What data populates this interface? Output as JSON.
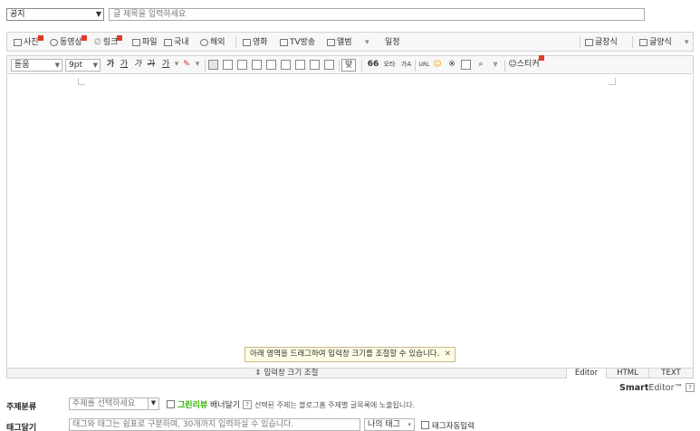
{
  "post": {
    "category": "공지",
    "title_placeholder": "글 제목을 입력하세요"
  },
  "toolbar1": {
    "photo": "사진",
    "video": "동영상",
    "link": "링크",
    "file": "파일",
    "domestic": "국내",
    "overseas": "해외",
    "movie": "영화",
    "tv": "TV방송",
    "album": "앨범",
    "schedule": "일정",
    "text_style": "글장식",
    "template": "글양식"
  },
  "toolbar2": {
    "font": "돋움",
    "size": "9pt",
    "bold": "가",
    "underline": "가",
    "italic": "가",
    "strike": "가",
    "font_color": "가",
    "bg_color": "가",
    "spell": "맞",
    "quote": "66",
    "tts": "오타",
    "sup": "가A",
    "url": "URL",
    "sticker": "스티커"
  },
  "editor": {
    "resize_tip": "아래 영역을 드래그하여 입력창 크기를 조절할 수 있습니다.",
    "resize_label": "⇕ 입력창 크기 조절",
    "modes": [
      "Editor",
      "HTML",
      "TEXT"
    ],
    "active_mode": "Editor",
    "brand_strong": "Smart",
    "brand_rest": "Editor™"
  },
  "topic": {
    "label": "주제분류",
    "placeholder": "주제를 선택하세요",
    "greenreview": "그린리뷰",
    "banner": "배너달기",
    "note": "선택된 주제는 블로그홈 주제별 글목록에 노출됩니다."
  },
  "tags": {
    "label": "태그달기",
    "placeholder": "태그와 태그는 쉼표로 구분하며, 30개까지 입력하실 수 있습니다.",
    "my_tags": "나의 태그",
    "auto": "태그자동입력"
  },
  "colors": {
    "new_badge": "#e23a28",
    "greenreview": "#2db400"
  }
}
